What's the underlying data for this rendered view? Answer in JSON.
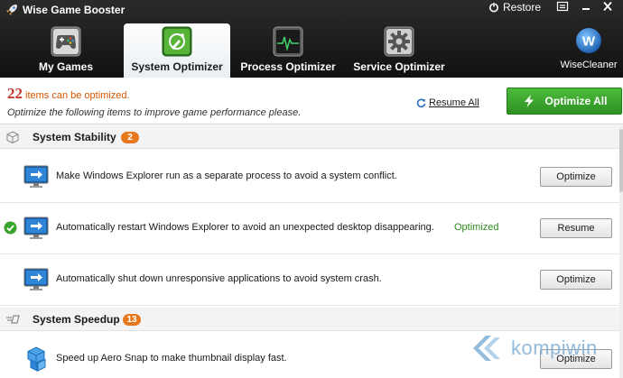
{
  "window": {
    "title": "Wise Game Booster",
    "restore_label": "Restore"
  },
  "nav": {
    "tabs": [
      {
        "label": "My Games",
        "icon": "gamepad-icon"
      },
      {
        "label": "System Optimizer",
        "icon": "system-optimizer-icon",
        "active": true
      },
      {
        "label": "Process Optimizer",
        "icon": "process-monitor-icon"
      },
      {
        "label": "Service Optimizer",
        "icon": "gear-icon"
      }
    ],
    "brand": "WiseCleaner",
    "brand_logo_letter": "W"
  },
  "summary": {
    "count": "22",
    "count_text": "items can be optimized.",
    "description": "Optimize the following items to improve game performance please.",
    "resume_all_label": "Resume All",
    "optimize_all_label": "Optimize All"
  },
  "sections": [
    {
      "title": "System Stability",
      "badge": "2",
      "items": [
        {
          "text": "Make Windows Explorer run as a separate process to avoid a system conflict.",
          "status": "",
          "button": "Optimize",
          "checked": false
        },
        {
          "text": "Automatically restart Windows Explorer to avoid an unexpected desktop disappearing.",
          "status": "Optimized",
          "button": "Resume",
          "checked": true
        },
        {
          "text": "Automatically shut down unresponsive applications to avoid system crash.",
          "status": "",
          "button": "Optimize",
          "checked": false
        }
      ]
    },
    {
      "title": "System Speedup",
      "badge": "13",
      "items": [
        {
          "text": "Speed up Aero Snap to make thumbnail display fast.",
          "status": "",
          "button": "Optimize",
          "checked": false
        }
      ]
    }
  ],
  "watermark": "kompiwin",
  "colors": {
    "header_bg": "#1a1a1a",
    "accent_green": "#3aa52c",
    "badge_orange": "#e6791e",
    "count_red": "#c0392b",
    "status_green": "#2e8b1e"
  }
}
